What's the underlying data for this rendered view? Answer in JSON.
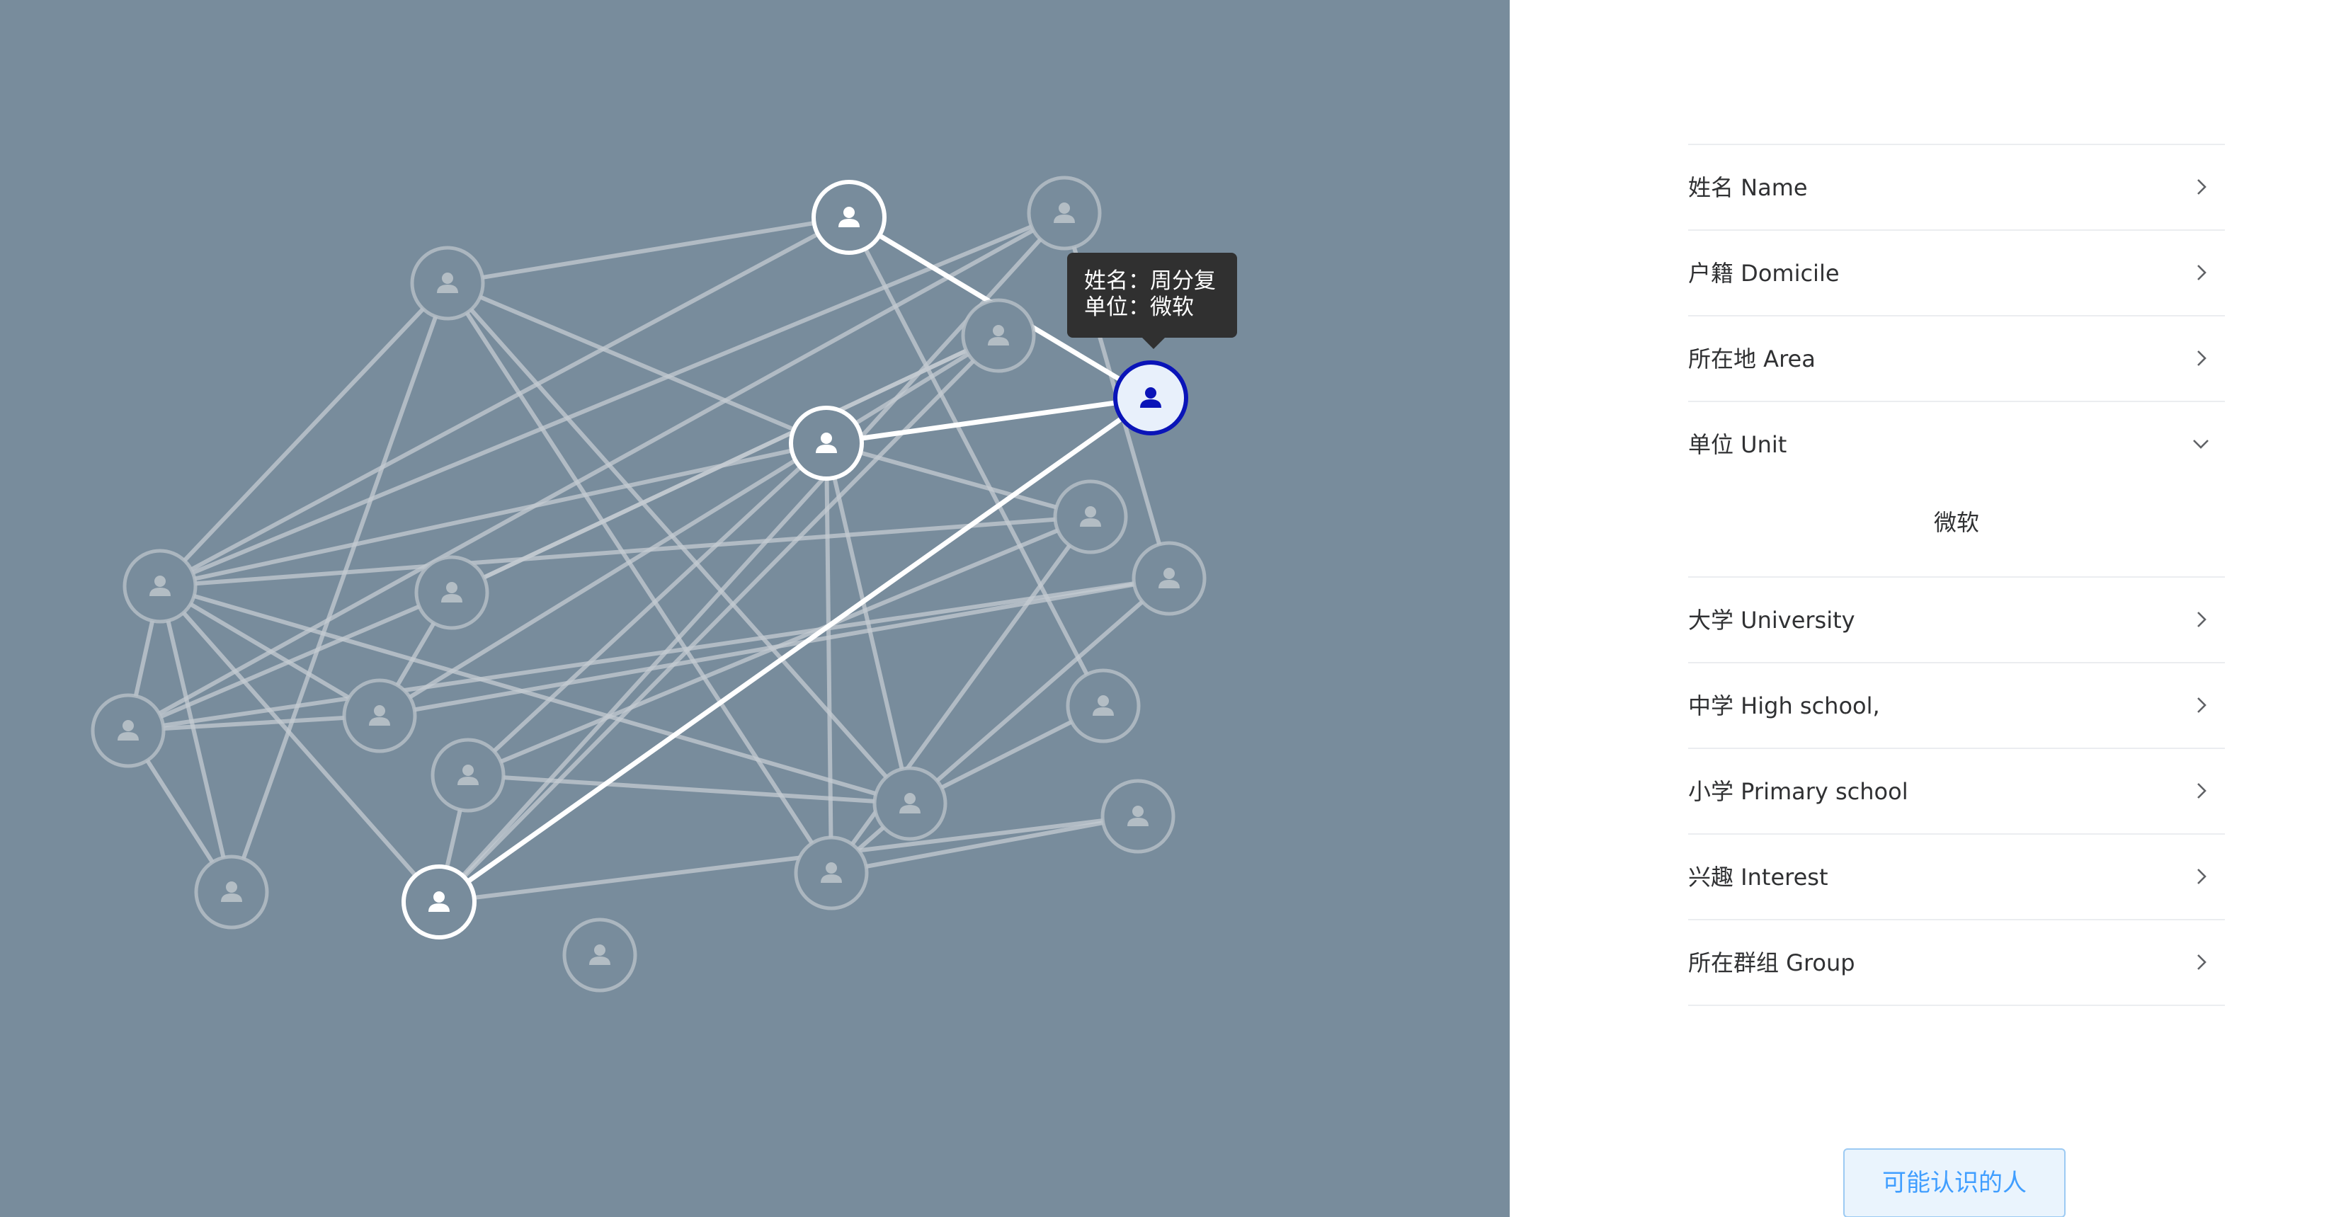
{
  "tooltip": {
    "name_line": "姓名：周分复",
    "unit_line": "单位：微软"
  },
  "menu": {
    "items": [
      {
        "label": "姓名 Name",
        "state": "collapsed"
      },
      {
        "label": "户籍 Domicile",
        "state": "collapsed"
      },
      {
        "label": "所在地 Area",
        "state": "collapsed"
      },
      {
        "label": "单位 Unit",
        "state": "expanded",
        "value": "微软"
      },
      {
        "label": "大学 University",
        "state": "collapsed"
      },
      {
        "label": "中学 High school,",
        "state": "collapsed"
      },
      {
        "label": "小学 Primary school",
        "state": "collapsed"
      },
      {
        "label": "兴趣 Interest",
        "state": "collapsed"
      },
      {
        "label": "所在群组 Group",
        "state": "collapsed"
      }
    ]
  },
  "cta": {
    "label": "可能认识的人"
  },
  "graph": {
    "node_icon": "person-icon",
    "colors": {
      "background": "#788c9c",
      "faded_edge": "#c4cbd1",
      "highlight_edge": "#ffffff",
      "selected_ring": "#0a14b8",
      "selected_fill": "#e8f0fb"
    }
  }
}
